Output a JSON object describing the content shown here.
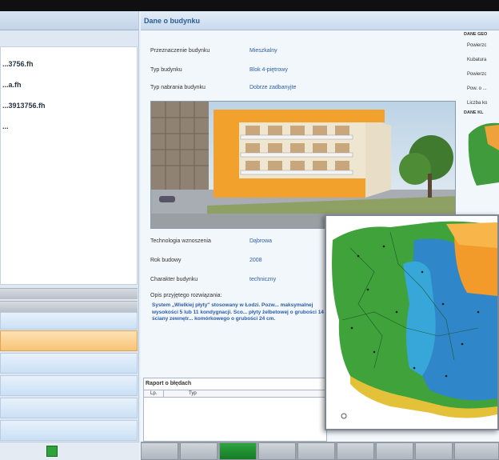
{
  "panel": {
    "title": "Dane o budynku"
  },
  "sidebar": {
    "items": [
      "...3756.fh",
      "...a.fh",
      "...3913756.fh",
      "..."
    ],
    "active_index": 0
  },
  "building": {
    "purpose_label": "Przeznaczenie budynku",
    "purpose_value": "Mieszkalny",
    "type_label": "Typ budynku",
    "type_value": "Blok 4-piętrowy",
    "condition_label": "Typ nabrania budynku",
    "condition_value": "Dobrze zadbanyjte",
    "tech_label": "Technologia wznoszenia",
    "tech_value": "Dąbrowa",
    "year_label": "Rok budowy",
    "year_value": "2008",
    "character_label": "Charakter budynku",
    "character_value": "techniczny",
    "solution_label": "Opis przyjętego rozwiązania:",
    "description": "System „Wielkiej płyty\" stosowany w Łodzi. Pozw... maksymalnej wysokości 5 lub 11 kondygnacji. Sco... płyty żelbetowej o grubości 14 cm, ściany zewnętr... komórkowego o grubości 24 cm."
  },
  "right_info": {
    "header1": "DANE GEO",
    "rows": [
      "Powierzc",
      "Kubatura",
      "Powierzc",
      "Pow. o ...",
      "Liczba ko"
    ],
    "header2": "DANE KL"
  },
  "report": {
    "title": "Raport o błędach",
    "col_lp": "Lp.",
    "col_typ": "Typ"
  },
  "bottom_tabs": {
    "count": 9,
    "active_index": 2
  },
  "colors": {
    "accent": "#2c5b93",
    "active_item": "#f8c477",
    "tab_active": "#1f8f30"
  }
}
